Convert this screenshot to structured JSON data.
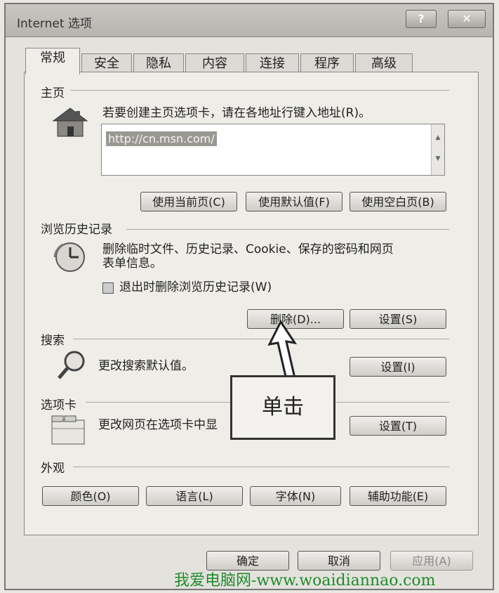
{
  "window": {
    "title": "Internet 选项"
  },
  "tabs": [
    "常规",
    "安全",
    "隐私",
    "内容",
    "连接",
    "程序",
    "高级"
  ],
  "homepage": {
    "section_title": "主页",
    "instruction": "若要创建主页选项卡，请在各地址行键入地址(R)。",
    "url": "http://cn.msn.com/",
    "use_current": "使用当前页(C)",
    "use_default": "使用默认值(F)",
    "use_blank": "使用空白页(B)"
  },
  "history": {
    "section_title": "浏览历史记录",
    "line1": "删除临时文件、历史记录、Cookie、保存的密码和网页",
    "line2": "表单信息。",
    "checkbox_label": "退出时删除浏览历史记录(W)",
    "delete_button": "删除(D)...",
    "settings_button": "设置(S)"
  },
  "search": {
    "section_title": "搜索",
    "desc": "更改搜索默认值。",
    "settings_button": "设置(I)"
  },
  "tabs_section": {
    "section_title": "选项卡",
    "desc": "更改网页在选项卡中显",
    "settings_button": "设置(T)"
  },
  "appearance": {
    "section_title": "外观",
    "colors": "颜色(O)",
    "languages": "语言(L)",
    "fonts": "字体(N)",
    "accessibility": "辅助功能(E)"
  },
  "footer": {
    "ok": "确定",
    "cancel": "取消",
    "apply": "应用(A)"
  },
  "callout": "单击",
  "watermark": "我爱电脑网-www.woaidiannao.com"
}
